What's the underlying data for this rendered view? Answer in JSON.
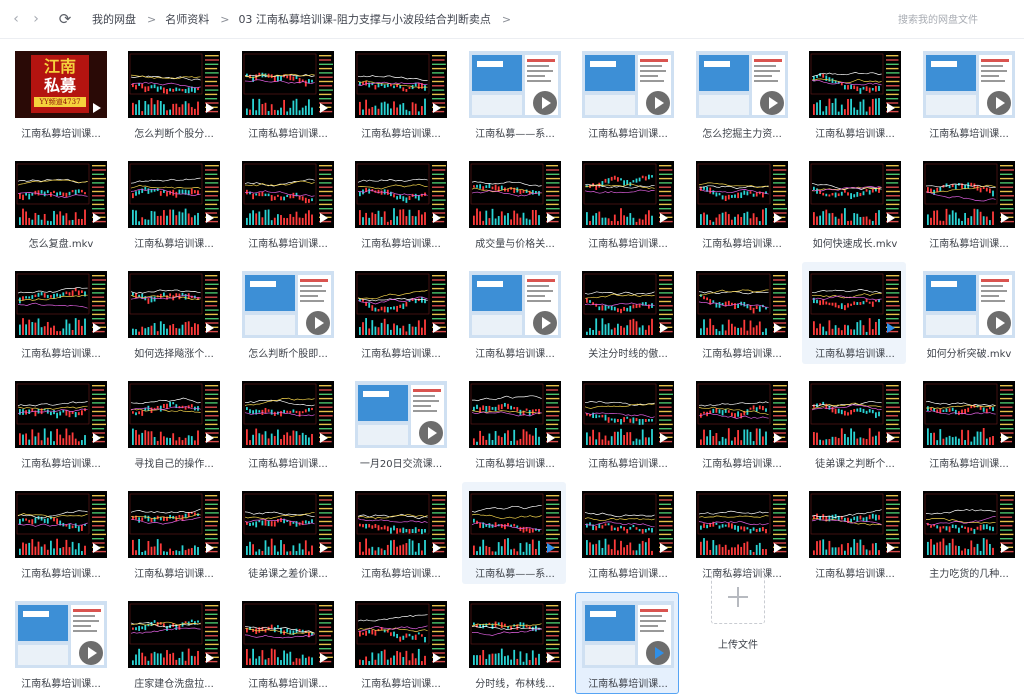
{
  "nav": {
    "back_icon": "chevron-left-icon",
    "forward_icon": "chevron-right-icon",
    "refresh_icon": "refresh-icon",
    "breadcrumb": [
      "我的网盘",
      "名师资料",
      "03 江南私募培训课-阻力支撑与小波段结合判断卖点"
    ],
    "separator": ">"
  },
  "search": {
    "placeholder": "搜索我的网盘文件"
  },
  "colors": {
    "accent": "#2f8fe8",
    "selected_bg": "#e5f0fd",
    "selected_border": "#56a4f4",
    "hover_bg": "#eef4fb"
  },
  "files": [
    {
      "name": "江南私募培训课...",
      "thumb": "logo"
    },
    {
      "name": "怎么判断个股分...",
      "thumb": "chart"
    },
    {
      "name": "江南私募培训课...",
      "thumb": "chart"
    },
    {
      "name": "江南私募培训课...",
      "thumb": "chart"
    },
    {
      "name": "江南私募——系...",
      "thumb": "screen"
    },
    {
      "name": "江南私募培训课...",
      "thumb": "screen"
    },
    {
      "name": "怎么挖掘主力资...",
      "thumb": "screen"
    },
    {
      "name": "江南私募培训课...",
      "thumb": "chart"
    },
    {
      "name": "江南私募培训课...",
      "thumb": "screen"
    },
    {
      "name": "怎么复盘.mkv",
      "thumb": "chart"
    },
    {
      "name": "江南私募培训课...",
      "thumb": "chart"
    },
    {
      "name": "江南私募培训课...",
      "thumb": "chart"
    },
    {
      "name": "江南私募培训课...",
      "thumb": "chart"
    },
    {
      "name": "成交量与价格关...",
      "thumb": "chart"
    },
    {
      "name": "江南私募培训课...",
      "thumb": "chart"
    },
    {
      "name": "江南私募培训课...",
      "thumb": "chart"
    },
    {
      "name": "如何快速成长.mkv",
      "thumb": "chart"
    },
    {
      "name": "江南私募培训课...",
      "thumb": "chart"
    },
    {
      "name": "江南私募培训课...",
      "thumb": "chart"
    },
    {
      "name": "如何选择飚涨个...",
      "thumb": "chart"
    },
    {
      "name": "怎么判断个股即...",
      "thumb": "screen"
    },
    {
      "name": "江南私募培训课...",
      "thumb": "chart"
    },
    {
      "name": "江南私募培训课...",
      "thumb": "screen"
    },
    {
      "name": "关注分时线的傲...",
      "thumb": "chart"
    },
    {
      "name": "江南私募培训课...",
      "thumb": "chart"
    },
    {
      "name": "江南私募培训课...",
      "thumb": "chart",
      "state": "hover"
    },
    {
      "name": "如何分析突破.mkv",
      "thumb": "screen"
    },
    {
      "name": "江南私募培训课...",
      "thumb": "chart"
    },
    {
      "name": "寻找自己的操作...",
      "thumb": "chart"
    },
    {
      "name": "江南私募培训课...",
      "thumb": "chart"
    },
    {
      "name": "一月20日交流课...",
      "thumb": "screen"
    },
    {
      "name": "江南私募培训课...",
      "thumb": "chart"
    },
    {
      "name": "江南私募培训课...",
      "thumb": "chart"
    },
    {
      "name": "江南私募培训课...",
      "thumb": "chart"
    },
    {
      "name": "徒弟课之判断个...",
      "thumb": "chart"
    },
    {
      "name": "江南私募培训课...",
      "thumb": "chart"
    },
    {
      "name": "江南私募培训课...",
      "thumb": "chart"
    },
    {
      "name": "江南私募培训课...",
      "thumb": "chart"
    },
    {
      "name": "徒弟课之差价课...",
      "thumb": "chart"
    },
    {
      "name": "江南私募培训课...",
      "thumb": "chart"
    },
    {
      "name": "江南私募——系...",
      "thumb": "chart",
      "state": "hover"
    },
    {
      "name": "江南私募培训课...",
      "thumb": "chart"
    },
    {
      "name": "江南私募培训课...",
      "thumb": "chart"
    },
    {
      "name": "江南私募培训课...",
      "thumb": "chart"
    },
    {
      "name": "主力吃货的几种...",
      "thumb": "chart"
    },
    {
      "name": "江南私募培训课...",
      "thumb": "screen"
    },
    {
      "name": "庄家建仓洗盘拉...",
      "thumb": "chart"
    },
    {
      "name": "江南私募培训课...",
      "thumb": "chart"
    },
    {
      "name": "江南私募培训课...",
      "thumb": "chart"
    },
    {
      "name": "分时线，布林线...",
      "thumb": "chart"
    },
    {
      "name": "江南私募培训课...",
      "thumb": "screen",
      "state": "selected"
    }
  ],
  "logo": {
    "line1": "江南",
    "line2": "私募",
    "tag": "YY频道4737"
  },
  "upload": {
    "label": "上传文件",
    "icon": "plus-icon"
  }
}
